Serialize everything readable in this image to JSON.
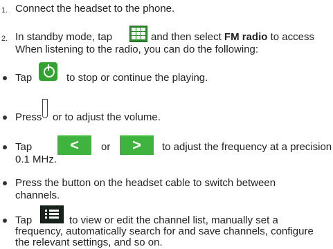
{
  "steps": {
    "step1": {
      "number": "1.",
      "text": "Connect the headset to the phone."
    },
    "step2": {
      "number": "2.",
      "text_a": "In standby mode, tap",
      "text_b": "and then select",
      "bold": "FM radio",
      "text_c": "to access",
      "line2": "When listening to the radio, you can do the following:"
    }
  },
  "bullets": {
    "stop": {
      "text_a": "Tap",
      "text_b": "to stop or continue the playing."
    },
    "volume": {
      "text_a": "Press",
      "text_b": "or to adjust the volume."
    },
    "frequency": {
      "text_a": "Tap",
      "text_or": "or",
      "text_b": "to adjust the frequency at a precision of",
      "line2": "0.1 MHz."
    },
    "switch": {
      "line1": "Press the button on the headset cable to switch between",
      "line2": "channels."
    },
    "list": {
      "text_a": "Tap",
      "text_b": "to view or edit the channel list, manually set a",
      "line2": "frequency, automatically search for and save channels, configure",
      "line3": "the relevant settings, and so on."
    }
  },
  "icons": {
    "menu_grid": "grid-menu-icon",
    "power": "power-icon",
    "volume_key": "volume-key-icon",
    "prev": "arrow-left-icon",
    "next": "arrow-right-icon",
    "list": "list-icon"
  },
  "colors": {
    "icon_green": "#3eb33e",
    "list_icon_bg": "#17221a"
  }
}
